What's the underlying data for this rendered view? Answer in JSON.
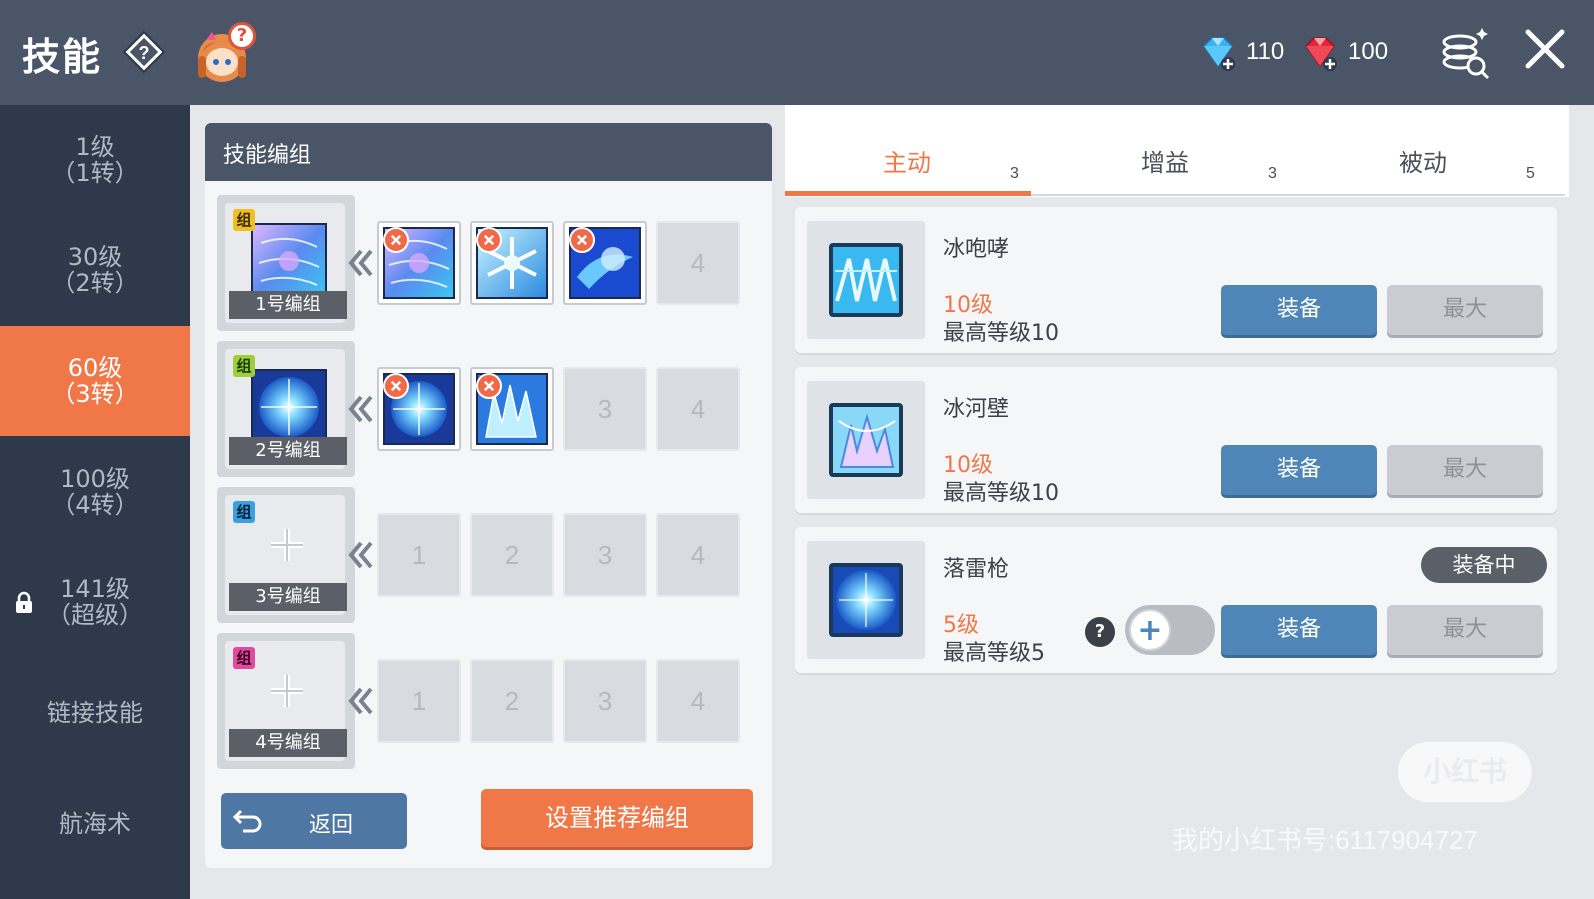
{
  "header": {
    "title": "技能",
    "currency": [
      {
        "icon": "blue-diamond-icon",
        "value": "110"
      },
      {
        "icon": "red-gem-icon",
        "value": "100"
      }
    ]
  },
  "sidebar": {
    "items": [
      {
        "line1": "1级",
        "line2": "（1转）",
        "active": false,
        "locked": false
      },
      {
        "line1": "30级",
        "line2": "（2转）",
        "active": false,
        "locked": false
      },
      {
        "line1": "60级",
        "line2": "（3转）",
        "active": true,
        "locked": false
      },
      {
        "line1": "100级",
        "line2": "（4转）",
        "active": false,
        "locked": false
      },
      {
        "line1": "141级",
        "line2": "（超级）",
        "active": false,
        "locked": true
      },
      {
        "line1": "链接技能",
        "line2": "",
        "active": false,
        "locked": false
      },
      {
        "line1": "航海术",
        "line2": "",
        "active": false,
        "locked": false
      }
    ]
  },
  "groups_panel": {
    "title": "技能编组",
    "badge": "组",
    "groups": [
      {
        "label": "1号编组",
        "badge_color": "#f0c020",
        "has_icon": true,
        "slots": [
          "skill",
          "skill",
          "skill",
          "4"
        ]
      },
      {
        "label": "2号编组",
        "badge_color": "#9bd03a",
        "has_icon": true,
        "slots": [
          "skill",
          "skill",
          "3",
          "4"
        ]
      },
      {
        "label": "3号编组",
        "badge_color": "#3aa0e0",
        "has_icon": false,
        "slots": [
          "1",
          "2",
          "3",
          "4"
        ]
      },
      {
        "label": "4号编组",
        "badge_color": "#e04aa0",
        "has_icon": false,
        "slots": [
          "1",
          "2",
          "3",
          "4"
        ]
      }
    ],
    "back_label": "返回",
    "recommend_label": "设置推荐编组"
  },
  "tabs": [
    {
      "label": "主动",
      "count": "3",
      "active": true
    },
    {
      "label": "增益",
      "count": "3",
      "active": false
    },
    {
      "label": "被动",
      "count": "5",
      "active": false
    }
  ],
  "skills": [
    {
      "name": "冰咆哮",
      "level": "10级",
      "max_level": "最高等级10",
      "equip": "装备",
      "max": "最大",
      "equipped": false
    },
    {
      "name": "冰河壁",
      "level": "10级",
      "max_level": "最高等级10",
      "equip": "装备",
      "max": "最大",
      "equipped": false
    },
    {
      "name": "落雷枪",
      "level": "5级",
      "max_level": "最高等级5",
      "equip": "装备",
      "max": "最大",
      "equipped": true,
      "equipped_label": "装备中"
    }
  ],
  "watermark": {
    "logo": "小红书",
    "text": "我的小红书号:6117904727"
  },
  "colors": {
    "accent": "#f07848",
    "header_bg": "#4a5568",
    "sidebar_bg": "#2e3a4b",
    "equip_button": "#4f86b8"
  }
}
